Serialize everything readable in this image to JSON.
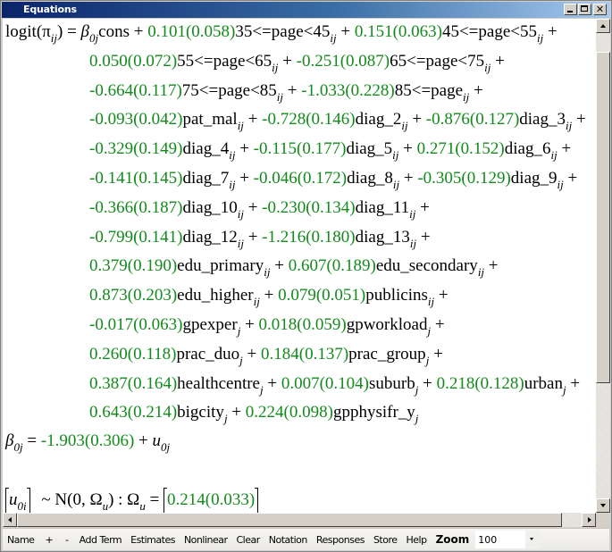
{
  "window": {
    "title": "Equations",
    "controls": [
      "minimize",
      "maximize",
      "close"
    ]
  },
  "colors": {
    "estimate_green": "#138a1c",
    "title_bar_start": "#0a246a",
    "title_bar_end": "#a6caf0"
  },
  "equation": {
    "lhs": "logit(π",
    "lhs_sub": "ij",
    "lhs_close": ") = ",
    "beta": "β",
    "beta_sub": "0j",
    "cons": "cons",
    "rows": [
      [
        {
          "est": "0.101",
          "se": "(0.058)",
          "var": "35<=page<45",
          "sub": "ij"
        },
        {
          "est": "0.151",
          "se": "(0.063)",
          "var": "45<=page<55",
          "sub": "ij"
        }
      ],
      [
        {
          "est": "0.050",
          "se": "(0.072)",
          "var": "55<=page<65",
          "sub": "ij"
        },
        {
          "est": "-0.251",
          "se": "(0.087)",
          "var": "65<=page<75",
          "sub": "ij"
        }
      ],
      [
        {
          "est": "-0.664",
          "se": "(0.117)",
          "var": "75<=page<85",
          "sub": "ij"
        },
        {
          "est": "-1.033",
          "se": "(0.228)",
          "var": "85<=page",
          "sub": "ij"
        }
      ],
      [
        {
          "est": "-0.093",
          "se": "(0.042)",
          "var": "pat_mal",
          "sub": "ij"
        },
        {
          "est": "-0.728",
          "se": "(0.146)",
          "var": "diag_2",
          "sub": "ij"
        },
        {
          "est": "-0.876",
          "se": "(0.127)",
          "var": "diag_3",
          "sub": "ij"
        }
      ],
      [
        {
          "est": "-0.329",
          "se": "(0.149)",
          "var": "diag_4",
          "sub": "ij"
        },
        {
          "est": "-0.115",
          "se": "(0.177)",
          "var": "diag_5",
          "sub": "ij"
        },
        {
          "est": "0.271",
          "se": "(0.152)",
          "var": "diag_6",
          "sub": "ij"
        }
      ],
      [
        {
          "est": "-0.141",
          "se": "(0.145)",
          "var": "diag_7",
          "sub": "ij"
        },
        {
          "est": "-0.046",
          "se": "(0.172)",
          "var": "diag_8",
          "sub": "ij"
        },
        {
          "est": "-0.305",
          "se": "(0.129)",
          "var": "diag_9",
          "sub": "ij"
        }
      ],
      [
        {
          "est": "-0.366",
          "se": "(0.187)",
          "var": "diag_10",
          "sub": "ij"
        },
        {
          "est": "-0.230",
          "se": "(0.134)",
          "var": "diag_11",
          "sub": "ij"
        }
      ],
      [
        {
          "est": "-0.799",
          "se": "(0.141)",
          "var": "diag_12",
          "sub": "ij"
        },
        {
          "est": "-1.216",
          "se": "(0.180)",
          "var": "diag_13",
          "sub": "ij"
        }
      ],
      [
        {
          "est": "0.379",
          "se": "(0.190)",
          "var": "edu_primary",
          "sub": "ij"
        },
        {
          "est": "0.607",
          "se": "(0.189)",
          "var": "edu_secondary",
          "sub": "ij"
        }
      ],
      [
        {
          "est": "0.873",
          "se": "(0.203)",
          "var": "edu_higher",
          "sub": "ij"
        },
        {
          "est": "0.079",
          "se": "(0.051)",
          "var": "publicins",
          "sub": "ij"
        }
      ],
      [
        {
          "est": "-0.017",
          "se": "(0.063)",
          "var": "gpexper",
          "sub": "j"
        },
        {
          "est": "0.018",
          "se": "(0.059)",
          "var": "gpworkload",
          "sub": "j"
        }
      ],
      [
        {
          "est": "0.260",
          "se": "(0.118)",
          "var": "prac_duo",
          "sub": "j"
        },
        {
          "est": "0.184",
          "se": "(0.137)",
          "var": "prac_group",
          "sub": "j"
        }
      ],
      [
        {
          "est": "0.387",
          "se": "(0.164)",
          "var": "healthcentre",
          "sub": "j"
        },
        {
          "est": "0.007",
          "se": "(0.104)",
          "var": "suburb",
          "sub": "j"
        },
        {
          "est": "0.218",
          "se": "(0.128)",
          "var": "urban",
          "sub": "j"
        }
      ],
      [
        {
          "est": "0.643",
          "se": "(0.214)",
          "var": "bigcity",
          "sub": "j"
        },
        {
          "est": "0.224",
          "se": "(0.098)",
          "var": "gpphysifr_y",
          "sub": "j"
        }
      ]
    ],
    "beta_eq": {
      "lhs": "β",
      "lhs_sub": "0j",
      "eq": " = ",
      "est": "-1.903",
      "se": "(0.306)",
      "plus": " + ",
      "u": "u",
      "u_sub": "0j"
    },
    "random": {
      "u": "u",
      "u_sub": "0i",
      "dist": "~ N(0,  Ω",
      "dist_sub": "u",
      "dist_close": ")  :  Ω",
      "omega_sub": "u",
      "eq": " = ",
      "est": "0.214",
      "se": "(0.033)"
    },
    "plus": " + "
  },
  "toolbar": {
    "items": [
      "Name",
      "+",
      "-",
      "Add Term",
      "Estimates",
      "Nonlinear",
      "Clear",
      "Notation",
      "Responses",
      "Store",
      "Help"
    ],
    "zoom_label": "Zoom",
    "zoom_value": "100"
  },
  "scroll": {
    "vertical_position": 0.0,
    "vertical_visible_fraction": 0.7,
    "horizontal_position": 0.0
  }
}
